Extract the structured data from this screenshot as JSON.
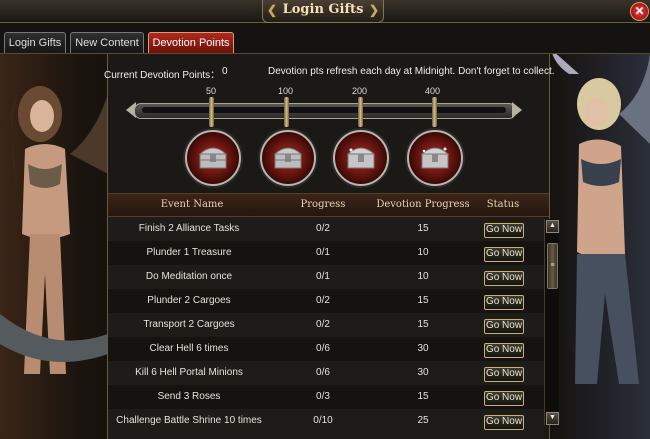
{
  "window": {
    "title": "Login Gifts",
    "close_glyph": "✕"
  },
  "tabs": [
    {
      "label": "Login Gifts",
      "active": false
    },
    {
      "label": "New Content",
      "active": false
    },
    {
      "label": "Devotion Points",
      "active": true
    }
  ],
  "devotion": {
    "current_label": "Current Devotion Points：",
    "current_value": "0",
    "refresh_note": "Devotion pts refresh each day at Midnight. Don't forget to collect."
  },
  "milestones": [
    {
      "points": "50",
      "icon": "treasure-chest-icon"
    },
    {
      "points": "100",
      "icon": "treasure-chest-icon"
    },
    {
      "points": "200",
      "icon": "treasure-chest-icon"
    },
    {
      "points": "400",
      "icon": "treasure-chest-icon"
    }
  ],
  "table": {
    "headers": {
      "name": "Event Name",
      "progress": "Progress",
      "devotion": "Devotion Progress",
      "status": "Status"
    },
    "rows": [
      {
        "name": "Finish 2 Alliance Tasks",
        "progress": "0/2",
        "devotion": "15",
        "status": "Go Now"
      },
      {
        "name": "Plunder 1 Treasure",
        "progress": "0/1",
        "devotion": "10",
        "status": "Go Now"
      },
      {
        "name": "Do Meditation once",
        "progress": "0/1",
        "devotion": "10",
        "status": "Go Now"
      },
      {
        "name": "Plunder 2 Cargoes",
        "progress": "0/2",
        "devotion": "15",
        "status": "Go Now"
      },
      {
        "name": "Transport 2 Cargoes",
        "progress": "0/2",
        "devotion": "15",
        "status": "Go Now"
      },
      {
        "name": "Clear Hell 6 times",
        "progress": "0/6",
        "devotion": "30",
        "status": "Go Now"
      },
      {
        "name": "Kill 6 Hell Portal Minions",
        "progress": "0/6",
        "devotion": "30",
        "status": "Go Now"
      },
      {
        "name": "Send 3 Roses",
        "progress": "0/3",
        "devotion": "15",
        "status": "Go Now"
      },
      {
        "name": "Challenge Battle Shrine 10 times",
        "progress": "0/10",
        "devotion": "25",
        "status": "Go Now"
      }
    ]
  },
  "scrollbar": {
    "up_glyph": "▲",
    "down_glyph": "▼",
    "grip_glyph": "≡"
  },
  "colors": {
    "accent_red": "#b0281e",
    "gold": "#c9a866",
    "panel": "#1b1915"
  }
}
